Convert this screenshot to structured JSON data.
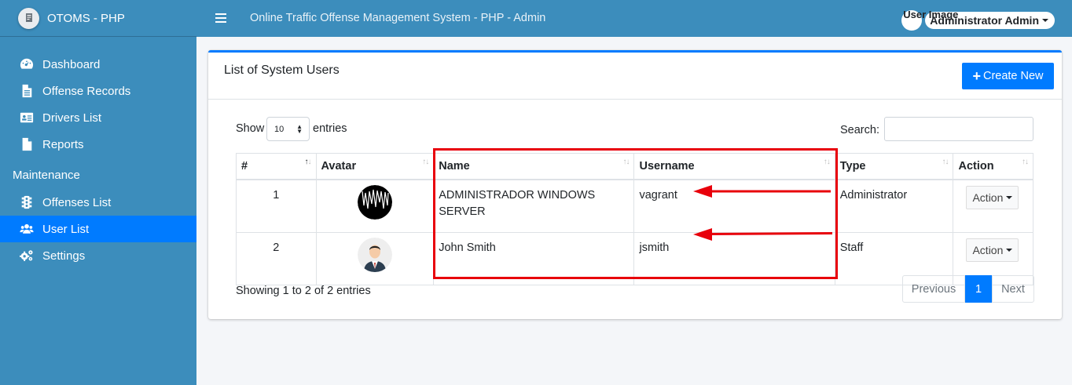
{
  "brand": {
    "name": "OTOMS - PHP"
  },
  "sidebar": {
    "items": [
      {
        "label": "Dashboard",
        "icon": "dashboard-icon"
      },
      {
        "label": "Offense Records",
        "icon": "file-icon"
      },
      {
        "label": "Drivers List",
        "icon": "id-card-icon"
      },
      {
        "label": "Reports",
        "icon": "file-icon"
      }
    ],
    "maintenance_header": "Maintenance",
    "maintenance_items": [
      {
        "label": "Offenses List",
        "icon": "traffic-light-icon"
      },
      {
        "label": "User List",
        "icon": "users-icon",
        "active": true
      },
      {
        "label": "Settings",
        "icon": "gears-icon"
      }
    ]
  },
  "topbar": {
    "title": "Online Traffic Offense Management System - PHP - Admin",
    "user_image_alt": "User Image",
    "user_name": "Administrator Admin"
  },
  "card": {
    "title": "List of System Users",
    "create_button": "Create New"
  },
  "table_controls": {
    "show_label": "Show",
    "page_length": "10",
    "entries_label": "entries",
    "search_label": "Search:",
    "info": "Showing 1 to 2 of 2 entries"
  },
  "table": {
    "columns": [
      "#",
      "Avatar",
      "Name",
      "Username",
      "Type",
      "Action"
    ],
    "rows": [
      {
        "num": "1",
        "name": "ADMINISTRADOR WINDOWS SERVER",
        "username": "vagrant",
        "type": "Administrator",
        "action": "Action"
      },
      {
        "num": "2",
        "name": "John Smith",
        "username": "jsmith",
        "type": "Staff",
        "action": "Action"
      }
    ]
  },
  "pagination": {
    "previous": "Previous",
    "current": "1",
    "next": "Next"
  },
  "colors": {
    "sidebar": "#3c8dbc",
    "primary": "#007bff",
    "annotation": "#e8000b"
  }
}
